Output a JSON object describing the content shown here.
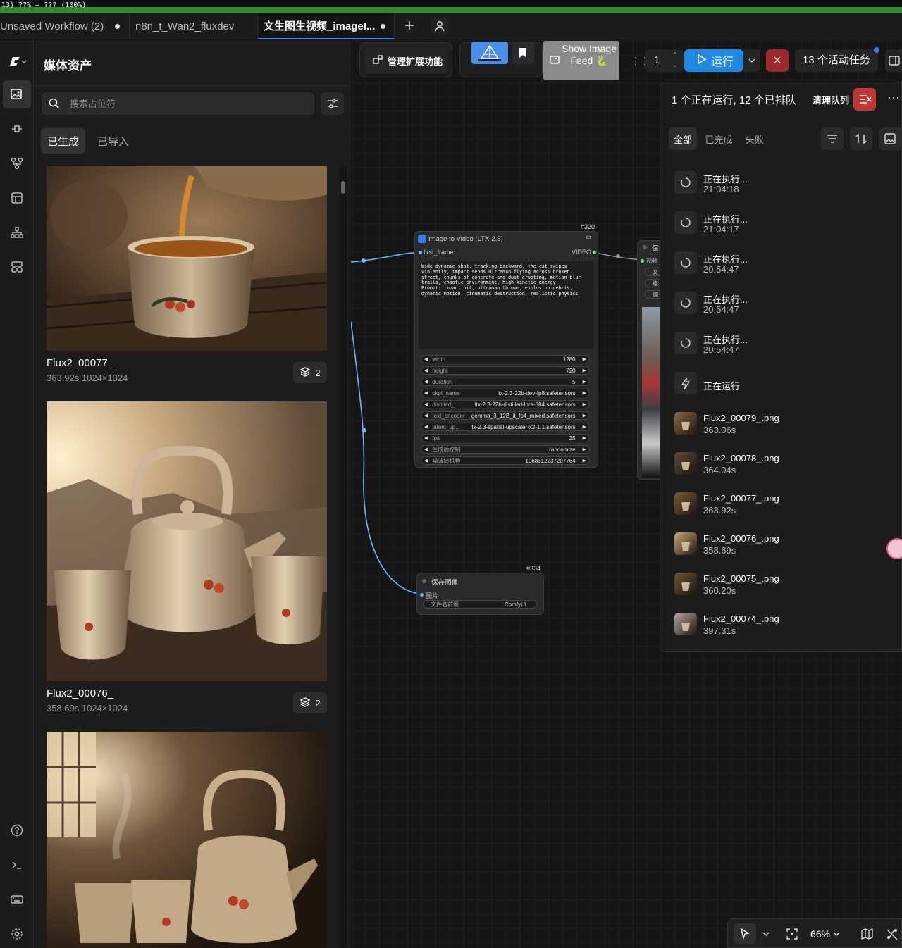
{
  "progress": {
    "text": "13) ??% – ??? (100%)",
    "percent": 100,
    "color": "#2f8a2a"
  },
  "tabs": [
    {
      "label": "Unsaved Workflow (2)",
      "modified": true
    },
    {
      "label": "n8n_t_Wan2_fluxdev",
      "modified": false
    },
    {
      "label": "文生图生视频_imageI...",
      "modified": true,
      "active": true
    }
  ],
  "rail": {
    "icons": [
      "comfy-logo-icon",
      "media-assets-icon",
      "node-library-icon",
      "model-library-icon",
      "workflows-icon",
      "templates-icon",
      "queue-layout-icon",
      "help-icon",
      "terminal-icon",
      "keyboard-icon",
      "settings-icon"
    ]
  },
  "media": {
    "title": "媒体资产",
    "search_placeholder": "搜索占位符",
    "tabs": [
      "已生成",
      "已导入"
    ],
    "assets": [
      {
        "name": "Flux2_00077_",
        "time": "363.92s",
        "size": "1024×1024",
        "count": "2"
      },
      {
        "name": "Flux2_00076_",
        "time": "358.69s",
        "size": "1024×1024",
        "count": "2"
      },
      {
        "name": "",
        "time": "",
        "size": "",
        "count": ""
      }
    ]
  },
  "toolbar": {
    "manage_label": "管理扩展功能",
    "feed_label": "Show Image Feed 🐍",
    "batch_count": "1",
    "run_label": "运行",
    "jobs_label": "13 个活动任务"
  },
  "nodes": {
    "i2v": {
      "id": "#320",
      "title": "Image to Video (LTX-2.3)",
      "input": "first_frame",
      "output": "VIDEO",
      "prompt": "Wide dynamic shot, tracking backward, the cat swipes violently, impact sends Ultraman flying across broken street, chunks of concrete and dust erupting, motion blur trails, chaotic environment, high kinetic energy\nPrompt: impact hit, ultraman thrown, explosion debris, dynamic motion, cinematic destruction, realistic physics",
      "widgets": [
        {
          "name": "width",
          "value": "1280"
        },
        {
          "name": "height",
          "value": "720"
        },
        {
          "name": "duration",
          "value": "5"
        },
        {
          "name": "ckpt_name",
          "value": "ltx-2.3-22b-dev-fp8.safetensors"
        },
        {
          "name": "distilled_l...",
          "value": "ltx-2.3-22b-distilled-lora-384.safetensors"
        },
        {
          "name": "text_encoder",
          "value": "gemma_3_12B_it_fp4_mixed.safetensors"
        },
        {
          "name": "latent_up...",
          "value": "ltx-2.3-spatial-upscaler-x2-1.1.safetensors"
        },
        {
          "name": "fps",
          "value": "25"
        },
        {
          "name": "生成后控制",
          "value": "randomize"
        },
        {
          "name": "噪波随机种",
          "value": "1068312237207764"
        }
      ]
    },
    "save": {
      "id": "#334",
      "title": "保存图像",
      "input": "图片",
      "widget_name": "文件名前缀",
      "widget_value": "ComfyUI"
    },
    "partial": {
      "title": "保",
      "input": "视频",
      "rows": [
        "文",
        "格",
        "编"
      ]
    }
  },
  "queue": {
    "status": "1 个正在运行, 12 个已排队",
    "clear_label": "清理队列",
    "tabs": [
      "全部",
      "已完成",
      "失败"
    ],
    "items": [
      {
        "title": "正在执行...",
        "sub": "21:04:18",
        "kind": "pending"
      },
      {
        "title": "正在执行...",
        "sub": "21:04:17",
        "kind": "pending"
      },
      {
        "title": "正在执行...",
        "sub": "20:54:47",
        "kind": "pending"
      },
      {
        "title": "正在执行...",
        "sub": "20:54:47",
        "kind": "pending"
      },
      {
        "title": "正在执行...",
        "sub": "20:54:47",
        "kind": "pending"
      },
      {
        "title": "正在运行",
        "sub": "",
        "kind": "running"
      },
      {
        "title": "Flux2_00079_.png",
        "sub": "363.06s",
        "kind": "done"
      },
      {
        "title": "Flux2_00078_.png",
        "sub": "364.04s",
        "kind": "done"
      },
      {
        "title": "Flux2_00077_.png",
        "sub": "363.92s",
        "kind": "done"
      },
      {
        "title": "Flux2_00076_.png",
        "sub": "358.69s",
        "kind": "done"
      },
      {
        "title": "Flux2_00075_.png",
        "sub": "360.20s",
        "kind": "done"
      },
      {
        "title": "Flux2_00074_.png",
        "sub": "397.31s",
        "kind": "done"
      }
    ]
  },
  "bottom": {
    "zoom": "66%"
  },
  "colors": {
    "accent": "#1f8ae6",
    "danger": "#c23535",
    "link": "#6bb7ff"
  }
}
